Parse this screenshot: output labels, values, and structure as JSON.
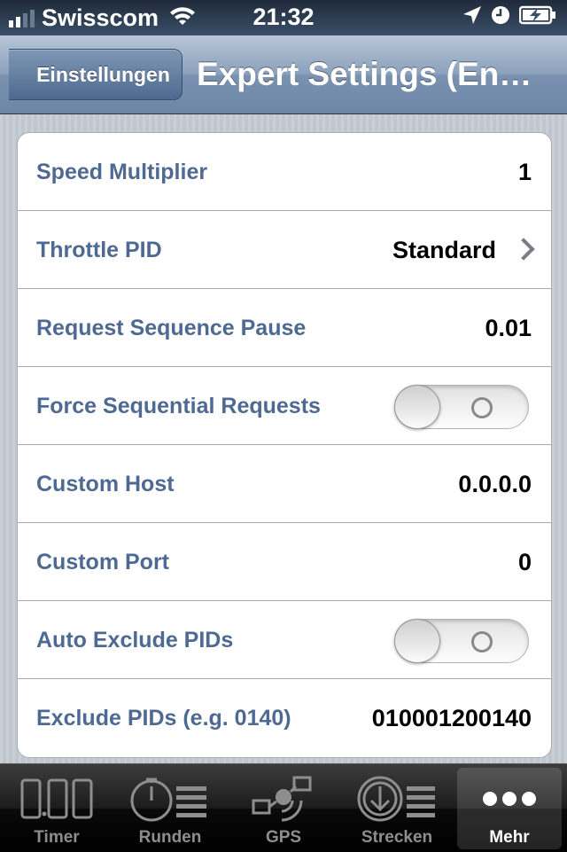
{
  "status_bar": {
    "carrier": "Swisscom",
    "time": "21:32",
    "signal_bars_active": 2,
    "icons": [
      "signal-bars-icon",
      "wifi-icon",
      "location-arrow-icon",
      "alarm-clock-icon",
      "battery-charging-icon"
    ]
  },
  "nav": {
    "back_label": "Einstellungen",
    "title": "Expert Settings (En…"
  },
  "settings": [
    {
      "label": "Speed Multiplier",
      "value": "1",
      "type": "value"
    },
    {
      "label": "Throttle PID",
      "value": "Standard",
      "type": "disclosure"
    },
    {
      "label": "Request Sequence Pause",
      "value": "0.01",
      "type": "value"
    },
    {
      "label": "Force Sequential Requests",
      "value": "",
      "type": "switch",
      "on": false
    },
    {
      "label": "Custom Host",
      "value": "0.0.0.0",
      "type": "value"
    },
    {
      "label": "Custom Port",
      "value": "0",
      "type": "value"
    },
    {
      "label": "Auto Exclude PIDs",
      "value": "",
      "type": "switch",
      "on": false
    },
    {
      "label": "Exclude PIDs (e.g. 0140)",
      "value": "010001200140",
      "type": "value"
    }
  ],
  "tabs": [
    {
      "label": "Timer",
      "icon": "digital-timer-icon",
      "selected": false
    },
    {
      "label": "Runden",
      "icon": "stopwatch-list-icon",
      "selected": false
    },
    {
      "label": "GPS",
      "icon": "satellite-icon",
      "selected": false
    },
    {
      "label": "Strecken",
      "icon": "download-list-icon",
      "selected": false
    },
    {
      "label": "Mehr",
      "icon": "more-dots-icon",
      "selected": true
    }
  ],
  "colors": {
    "label_blue": "#4e6a92",
    "nav_bar": "#7a92b0",
    "tab_inactive": "#8e8e8e"
  }
}
